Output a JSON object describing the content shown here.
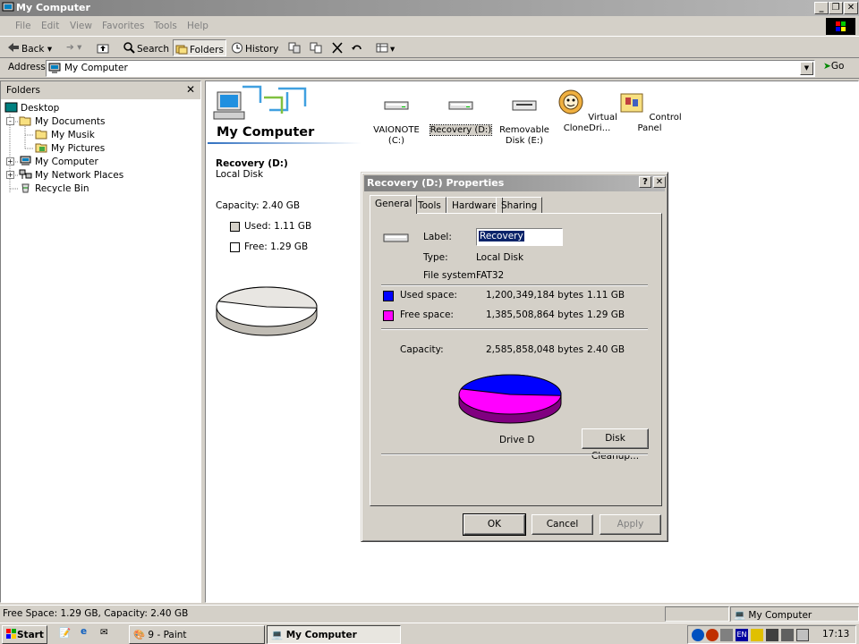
{
  "window": {
    "title": "My Computer"
  },
  "menu": [
    "File",
    "Edit",
    "View",
    "Favorites",
    "Tools",
    "Help"
  ],
  "toolbar": {
    "back": "Back",
    "search": "Search",
    "folders": "Folders",
    "history": "History"
  },
  "address": {
    "label": "Address",
    "value": "My Computer",
    "go": "Go"
  },
  "folders_pane": {
    "title": "Folders",
    "tree": [
      "Desktop",
      "My Documents",
      "My Musik",
      "My Pictures",
      "My Computer",
      "My Network Places",
      "Recycle Bin"
    ]
  },
  "main": {
    "heading": "My Computer",
    "selected": {
      "name": "Recovery (D:)",
      "type": "Local Disk",
      "capacity": "Capacity: 2.40 GB",
      "used": "Used: 1.11 GB",
      "free": "Free: 1.29 GB"
    },
    "drives": [
      {
        "line1": "VAIONOTE",
        "line2": "(C:)",
        "icon": "hard-drive-icon"
      },
      {
        "line1": "Recovery (D:)",
        "line2": "",
        "icon": "hard-drive-icon"
      },
      {
        "line1": "Removable",
        "line2": "Disk (E:)",
        "icon": "removable-disk-icon"
      },
      {
        "line1": "Virtual",
        "line2": "CloneDri...",
        "icon": "virtual-drive-icon"
      },
      {
        "line1": "Control Panel",
        "line2": "",
        "icon": "control-panel-icon"
      }
    ],
    "used_fraction": 0.464
  },
  "dialog": {
    "title": "Recovery (D:) Properties",
    "tabs": [
      "General",
      "Tools",
      "Hardware",
      "Sharing"
    ],
    "label_caption": "Label:",
    "label_value": "Recovery",
    "type_caption": "Type:",
    "type_value": "Local Disk",
    "fs_caption": "File system:",
    "fs_value": "FAT32",
    "used_caption": "Used space:",
    "used_bytes": "1,200,349,184 bytes",
    "used_gb": "1.11 GB",
    "free_caption": "Free space:",
    "free_bytes": "1,385,508,864 bytes",
    "free_gb": "1.29 GB",
    "cap_caption": "Capacity:",
    "cap_bytes": "2,585,858,048 bytes",
    "cap_gb": "2.40 GB",
    "pie_label": "Drive D",
    "cleanup": "Disk Cleanup...",
    "ok": "OK",
    "cancel": "Cancel",
    "apply": "Apply",
    "used_color": "#0000ff",
    "free_color": "#ff00ff"
  },
  "statusbar": {
    "left": "Free Space: 1.29 GB, Capacity: 2.40 GB",
    "right": "My Computer"
  },
  "taskbar": {
    "start": "Start",
    "tasks": [
      "9 - Paint",
      "My Computer"
    ],
    "lang": "EN",
    "clock": "17:13"
  }
}
